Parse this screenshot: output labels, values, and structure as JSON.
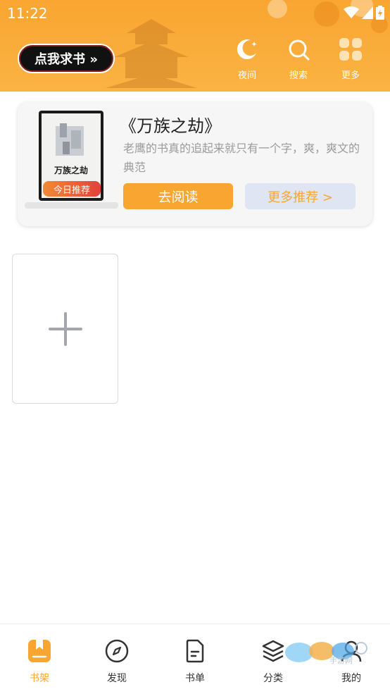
{
  "status_bar": {
    "time": "11:22"
  },
  "header": {
    "seek_button_label": "点我求书 »",
    "actions": [
      {
        "label": "夜间",
        "icon": "moon-icon"
      },
      {
        "label": "搜索",
        "icon": "search-icon"
      },
      {
        "label": "更多",
        "icon": "grid-icon"
      }
    ]
  },
  "recommendation": {
    "cover_title": "万族之劫",
    "badge": "今日推荐",
    "title": "《万族之劫》",
    "description": "老鹰的书真的追起来就只有一个字，爽，爽文的典范",
    "read_button": "去阅读",
    "more_button": "更多推荐 >"
  },
  "bookshelf": {
    "add_icon": "plus-icon"
  },
  "bottom_nav": [
    {
      "label": "书架",
      "icon": "bookshelf-icon",
      "active": true
    },
    {
      "label": "发现",
      "icon": "compass-icon",
      "active": false
    },
    {
      "label": "书单",
      "icon": "booklist-icon",
      "active": false
    },
    {
      "label": "分类",
      "icon": "layers-icon",
      "active": false
    },
    {
      "label": "我的",
      "icon": "profile-icon",
      "active": false
    }
  ],
  "watermark": {
    "text": "手游网"
  },
  "colors": {
    "accent": "#f9a531",
    "badge_red": "#e2413b",
    "more_button_bg": "#dfe5f2"
  }
}
